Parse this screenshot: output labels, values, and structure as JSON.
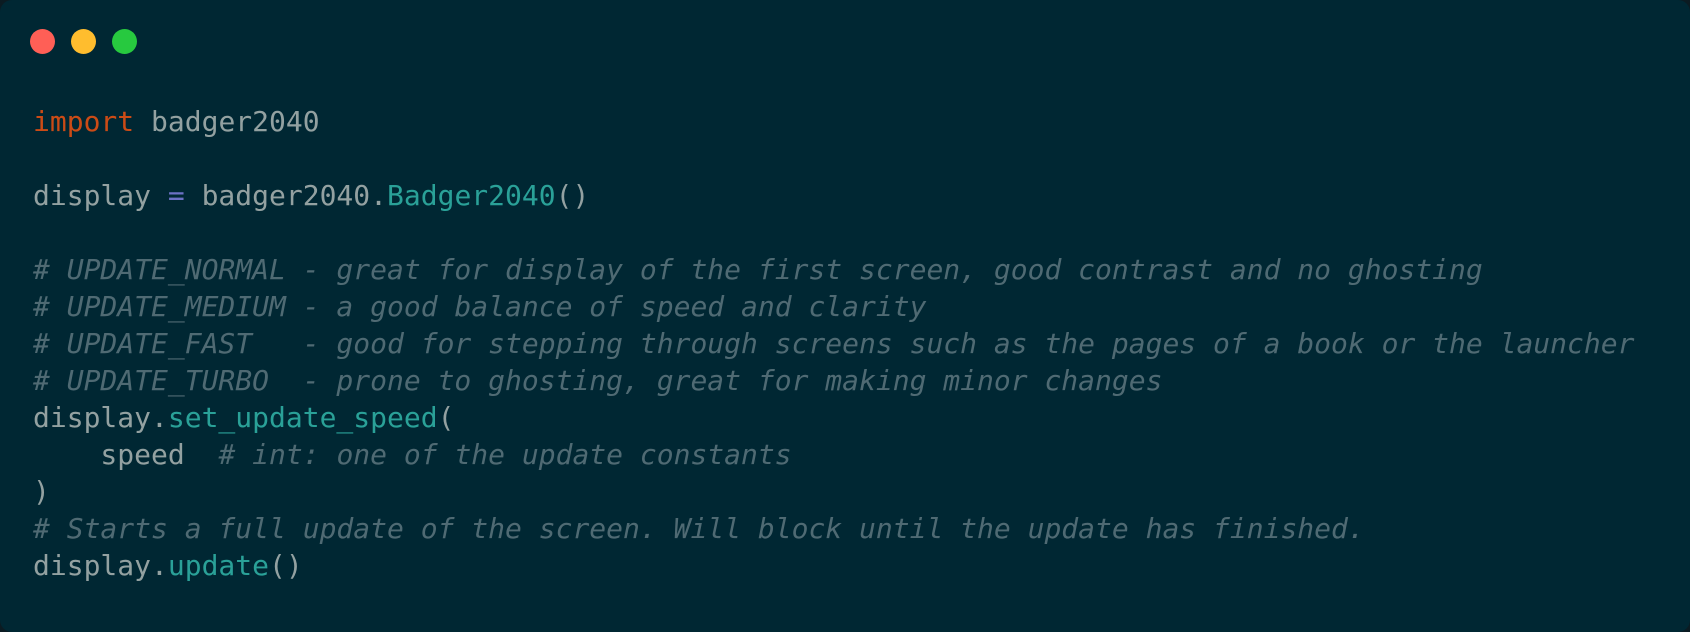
{
  "window": {
    "traffic_lights": [
      {
        "name": "close",
        "color": "#ff5f56"
      },
      {
        "name": "minimize",
        "color": "#ffbd2e"
      },
      {
        "name": "maximize",
        "color": "#27c93f"
      }
    ]
  },
  "colors": {
    "background": "#002733",
    "plain": "#93a1a1",
    "keyword": "#cb4b16",
    "function": "#2aa198",
    "operator": "#6c71c4",
    "comment": "#4f6a73"
  },
  "code": {
    "lines": [
      [
        {
          "t": "import",
          "k": "keyword"
        },
        {
          "t": " badger2040",
          "k": "plain"
        }
      ],
      [],
      [
        {
          "t": "display ",
          "k": "plain"
        },
        {
          "t": "=",
          "k": "operator"
        },
        {
          "t": " badger2040.",
          "k": "plain"
        },
        {
          "t": "Badger2040",
          "k": "function"
        },
        {
          "t": "()",
          "k": "plain"
        }
      ],
      [],
      [
        {
          "t": "# UPDATE_NORMAL - great for display of the first screen, good contrast and no ghosting",
          "k": "comment"
        }
      ],
      [
        {
          "t": "# UPDATE_MEDIUM - a good balance of speed and clarity",
          "k": "comment"
        }
      ],
      [
        {
          "t": "# UPDATE_FAST   - good for stepping through screens such as the pages of a book or the launcher",
          "k": "comment"
        }
      ],
      [
        {
          "t": "# UPDATE_TURBO  - prone to ghosting, great for making minor changes",
          "k": "comment"
        }
      ],
      [
        {
          "t": "display.",
          "k": "plain"
        },
        {
          "t": "set_update_speed",
          "k": "function"
        },
        {
          "t": "(",
          "k": "plain"
        }
      ],
      [
        {
          "t": "    speed  ",
          "k": "plain"
        },
        {
          "t": "# int: one of the update constants",
          "k": "comment"
        }
      ],
      [
        {
          "t": ")",
          "k": "plain"
        }
      ],
      [
        {
          "t": "# Starts a full update of the screen. Will block until the update has finished.",
          "k": "comment"
        }
      ],
      [
        {
          "t": "display.",
          "k": "plain"
        },
        {
          "t": "update",
          "k": "function"
        },
        {
          "t": "()",
          "k": "plain"
        }
      ]
    ]
  }
}
